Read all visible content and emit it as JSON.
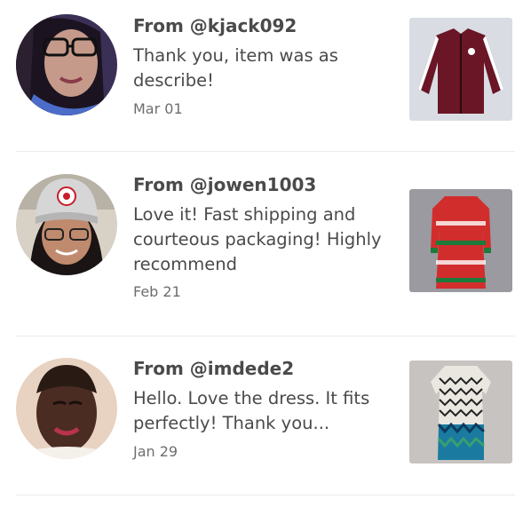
{
  "reviews": [
    {
      "from": "From @kjack092",
      "message": "Thank you, item was as describe!",
      "date": "Mar 01",
      "avatar_icon": "user-avatar-photo",
      "item_icon": "maroon-track-jacket-photo"
    },
    {
      "from": "From @jowen1003",
      "message": "Love it! Fast shipping and courteous packaging! Highly recommend",
      "date": "Feb 21",
      "avatar_icon": "user-avatar-photo",
      "item_icon": "red-holiday-dress-photo"
    },
    {
      "from": "From @imdede2",
      "message": "Hello. Love the dress. It fits perfectly! Thank you...",
      "date": "Jan 29",
      "avatar_icon": "user-avatar-photo",
      "item_icon": "patterned-dress-photo"
    }
  ],
  "colors": {
    "text": "#4a4a4a",
    "date": "#6e6e6e",
    "divider": "#ececec"
  }
}
